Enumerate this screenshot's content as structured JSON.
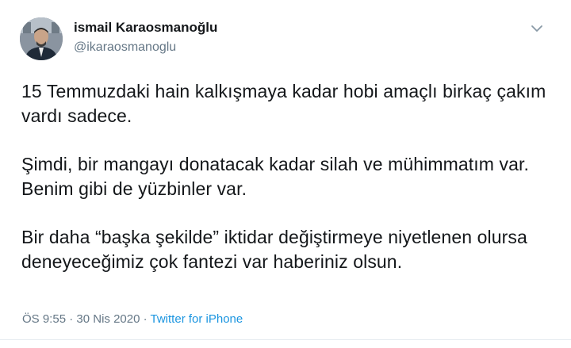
{
  "author": {
    "display_name": "ismail Karaosmanoğlu",
    "handle": "@ikaraosmanoglu",
    "avatar_icon": "profile-photo"
  },
  "tweet": {
    "paragraphs": [
      "15 Temmuzdaki hain kalkışmaya kadar hobi amaçlı birkaç çakım vardı sadece.",
      "Şimdi, bir mangayı donatacak kadar silah ve mühimmatım var. Benim gibi de yüzbinler var.",
      "Bir daha “başka şekilde” iktidar değiştirmeye niyetlenen olursa deneyeceğimiz çok fantezi var haberiniz olsun."
    ]
  },
  "meta": {
    "time": "ÖS 9:55",
    "separator": " · ",
    "date": "30 Nis 2020",
    "source": "Twitter for iPhone"
  },
  "icons": {
    "menu": "chevron-down-icon"
  },
  "colors": {
    "text": "#14171a",
    "secondary": "#657786",
    "link": "#1b95e0"
  }
}
